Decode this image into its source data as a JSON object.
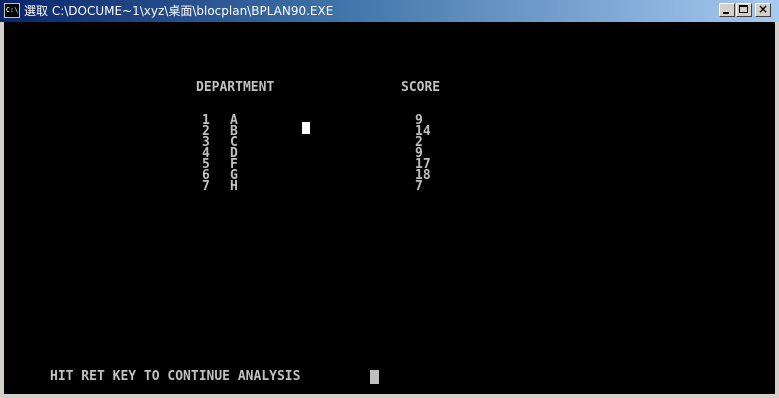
{
  "window": {
    "title": "選取 C:\\DOCUME~1\\xyz\\桌面\\blocplan\\BPLAN90.EXE",
    "icon_label": "C:\\",
    "controls": {
      "minimize": "minimize",
      "maximize": "maximize",
      "close": "×"
    }
  },
  "console": {
    "headers": {
      "department": "DEPARTMENT",
      "score": "SCORE"
    },
    "rows": [
      {
        "num": "1",
        "letter": "A",
        "score": "9"
      },
      {
        "num": "2",
        "letter": "B",
        "score": "14"
      },
      {
        "num": "3",
        "letter": "C",
        "score": "2"
      },
      {
        "num": "4",
        "letter": "D",
        "score": "9"
      },
      {
        "num": "5",
        "letter": "F",
        "score": "17"
      },
      {
        "num": "6",
        "letter": "G",
        "score": "18"
      },
      {
        "num": "7",
        "letter": "H",
        "score": "7"
      }
    ],
    "prompt": "HIT RET KEY TO CONTINUE ANALYSIS"
  },
  "colors": {
    "console_bg": "#000000",
    "console_text": "#c0c0c0",
    "titlebar_start": "#0a246a",
    "titlebar_end": "#a6caf0"
  }
}
